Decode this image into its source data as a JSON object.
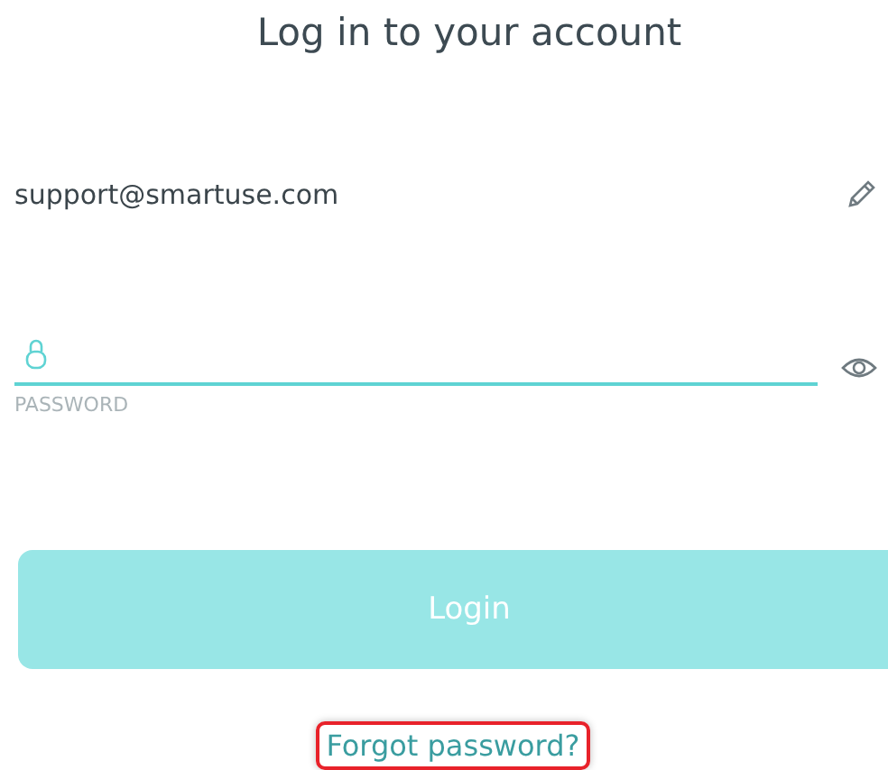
{
  "title": "Log in to your account",
  "email": {
    "value": "support@smartuse.com"
  },
  "password": {
    "label": "PASSWORD"
  },
  "login_button": {
    "label": "Login",
    "disabled": true
  },
  "forgot_link": {
    "label": "Forgot password?",
    "highlighted": true
  }
}
